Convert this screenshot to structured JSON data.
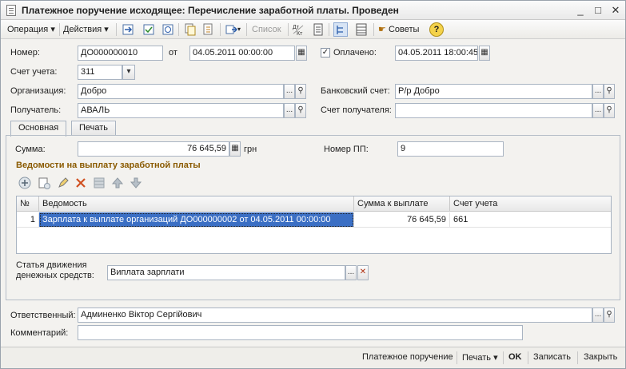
{
  "window": {
    "title": "Платежное поручение исходящее: Перечисление заработной платы. Проведен",
    "min": "_",
    "max": "□",
    "close": "✕"
  },
  "toolbar": {
    "operation": "Операция",
    "actions": "Действия",
    "list": "Список",
    "advice": "Советы",
    "dtkt": "Дт Кт",
    "help": "?"
  },
  "header": {
    "number_label": "Номер:",
    "number_value": "ДО000000010",
    "from_label": "от",
    "date_value": "04.05.2011 00:00:00",
    "paid_label": "Оплачено:",
    "paid_checked": "✓",
    "paid_date": "04.05.2011 18:00:45",
    "account_label": "Счет учета:",
    "account_value": "311",
    "org_label": "Организация:",
    "org_value": "Добро",
    "bank_label": "Банковский счет:",
    "bank_value": "Р/р Добро",
    "recipient_label": "Получатель:",
    "recipient_value": "АВАЛЬ",
    "recipient_acc_label": "Счет получателя:",
    "recipient_acc_value": "",
    "dots": "...",
    "clear": "✕"
  },
  "tabs": [
    {
      "label": "Основная"
    },
    {
      "label": "Печать"
    }
  ],
  "main": {
    "sum_label": "Сумма:",
    "sum_value": "76 645,59",
    "currency": "грн",
    "pp_label": "Номер ПП:",
    "pp_value": "9",
    "section_title": "Ведомости на выплату заработной платы",
    "columns": [
      "№",
      "Ведомость",
      "Сумма к выплате",
      "Счет учета"
    ],
    "rows": [
      {
        "n": "1",
        "doc": "Зарплата к выплате организаций ДО000000002 от 04.05.2011 00:00:00",
        "sum": "76 645,59",
        "acc": "661"
      }
    ],
    "cashflow_label_1": "Статья движения",
    "cashflow_label_2": "денежных средств:",
    "cashflow_value": "Виплата зарплати"
  },
  "footer": {
    "resp_label": "Ответственный:",
    "resp_value": "Админенко Віктор Сергійович",
    "comment_label": "Комментарий:",
    "comment_value": ""
  },
  "statusbar": {
    "payment": "Платежное поручение",
    "print": "Печать",
    "ok": "OK",
    "save": "Записать",
    "close": "Закрыть"
  },
  "colors": {
    "accent": "#3b6fc4",
    "section": "#8a5a00",
    "border": "#a9b4c2"
  }
}
